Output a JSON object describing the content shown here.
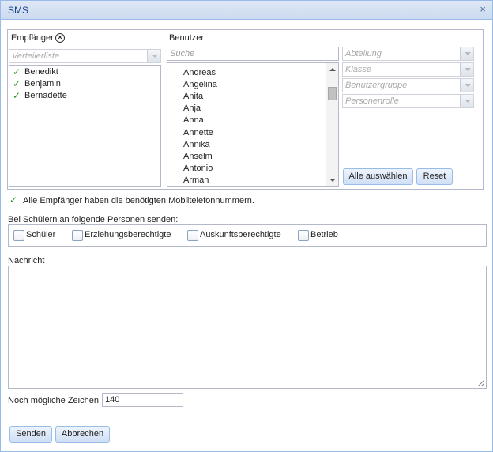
{
  "window": {
    "title": "SMS",
    "close_icon": "×"
  },
  "recipients": {
    "label": "Empfänger",
    "distribution_list": {
      "placeholder": "Verteilerliste"
    },
    "items": [
      {
        "label": "Benedikt"
      },
      {
        "label": "Benjamin"
      },
      {
        "label": "Bernadette"
      }
    ]
  },
  "users": {
    "label": "Benutzer",
    "search": {
      "placeholder": "Suche"
    },
    "items": [
      "Andreas",
      "Angelina",
      "Anita",
      "Anja",
      "Anna",
      "Annette",
      "Annika",
      "Anselm",
      "Antonio",
      "Arman"
    ],
    "filters": {
      "department": "Abteilung",
      "class": "Klasse",
      "user_group": "Benutzergruppe",
      "person_role": "Personenrolle"
    },
    "select_all_button": "Alle auswählen",
    "reset_button": "Reset"
  },
  "status_message": "Alle Empfänger haben die benötigten Mobiltelefonnummern.",
  "send_to": {
    "label": "Bei Schülern an folgende Personen senden:",
    "options": [
      {
        "label": "Schüler",
        "checked": false
      },
      {
        "label": "Erziehungsberechtigte",
        "checked": false
      },
      {
        "label": "Auskunftsberechtigte",
        "checked": false
      },
      {
        "label": "Betrieb",
        "checked": false
      }
    ]
  },
  "message": {
    "label": "Nachricht",
    "value": ""
  },
  "chars_remaining": {
    "label": "Noch mögliche Zeichen:",
    "value": "140"
  },
  "footer": {
    "send_button": "Senden",
    "cancel_button": "Abbrechen"
  },
  "colors": {
    "check": "#2a9a2a",
    "title": "#15428b",
    "border": "#99bbe8"
  }
}
